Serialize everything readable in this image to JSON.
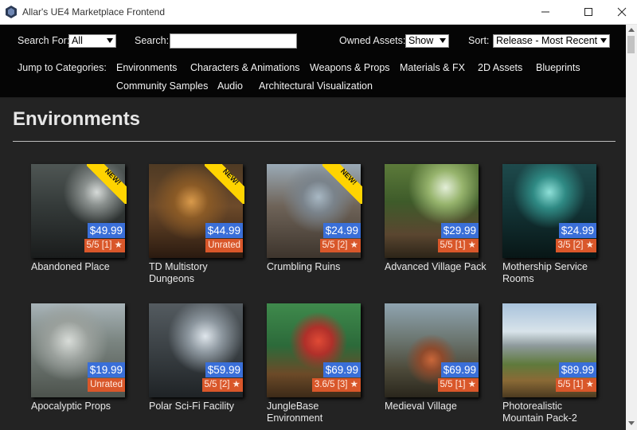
{
  "window": {
    "title": "Allar's UE4 Marketplace Frontend"
  },
  "toolbar": {
    "search_for_label": "Search For:",
    "search_for_value": "All",
    "search_label": "Search:",
    "search_value": "",
    "owned_label": "Owned Assets:",
    "owned_value": "Show",
    "sort_label": "Sort:",
    "sort_value": "Release - Most Recent"
  },
  "categories": {
    "label": "Jump to Categories:",
    "items": [
      "Environments",
      "Characters & Animations",
      "Weapons & Props",
      "Materials & FX",
      "2D Assets",
      "Blueprints",
      "Community Samples",
      "Audio",
      "Architectural Visualization"
    ]
  },
  "section": {
    "title": "Environments"
  },
  "new_badge": "NEW!",
  "colors": {
    "toolbar_bg": "#050505",
    "content_bg": "#232323",
    "price_bg": "#3a6fd8",
    "rating_bg": "#d9572a",
    "new_badge": "#ffd400"
  },
  "products": [
    {
      "name": "Abandoned Place",
      "price": "$49.99",
      "rating": "5/5 [1] ★",
      "new": true
    },
    {
      "name": "TD Multistory Dungeons",
      "price": "$44.99",
      "rating": "Unrated",
      "new": true
    },
    {
      "name": "Crumbling Ruins",
      "price": "$24.99",
      "rating": "5/5 [2] ★",
      "new": true
    },
    {
      "name": "Advanced Village Pack",
      "price": "$29.99",
      "rating": "5/5 [1] ★",
      "new": false
    },
    {
      "name": "Mothership Service Rooms",
      "price": "$24.99",
      "rating": "3/5 [2] ★",
      "new": false
    },
    {
      "name": "Apocalyptic Props",
      "price": "$19.99",
      "rating": "Unrated",
      "new": false
    },
    {
      "name": "Polar Sci-Fi Facility",
      "price": "$59.99",
      "rating": "5/5 [2] ★",
      "new": false
    },
    {
      "name": "JungleBase Environment",
      "price": "$69.99",
      "rating": "3.6/5 [3] ★",
      "new": false
    },
    {
      "name": "Medieval Village",
      "price": "$69.99",
      "rating": "5/5 [1] ★",
      "new": false
    },
    {
      "name": "Photorealistic Mountain Pack-2",
      "price": "$89.99",
      "rating": "5/5 [1] ★",
      "new": false
    }
  ]
}
